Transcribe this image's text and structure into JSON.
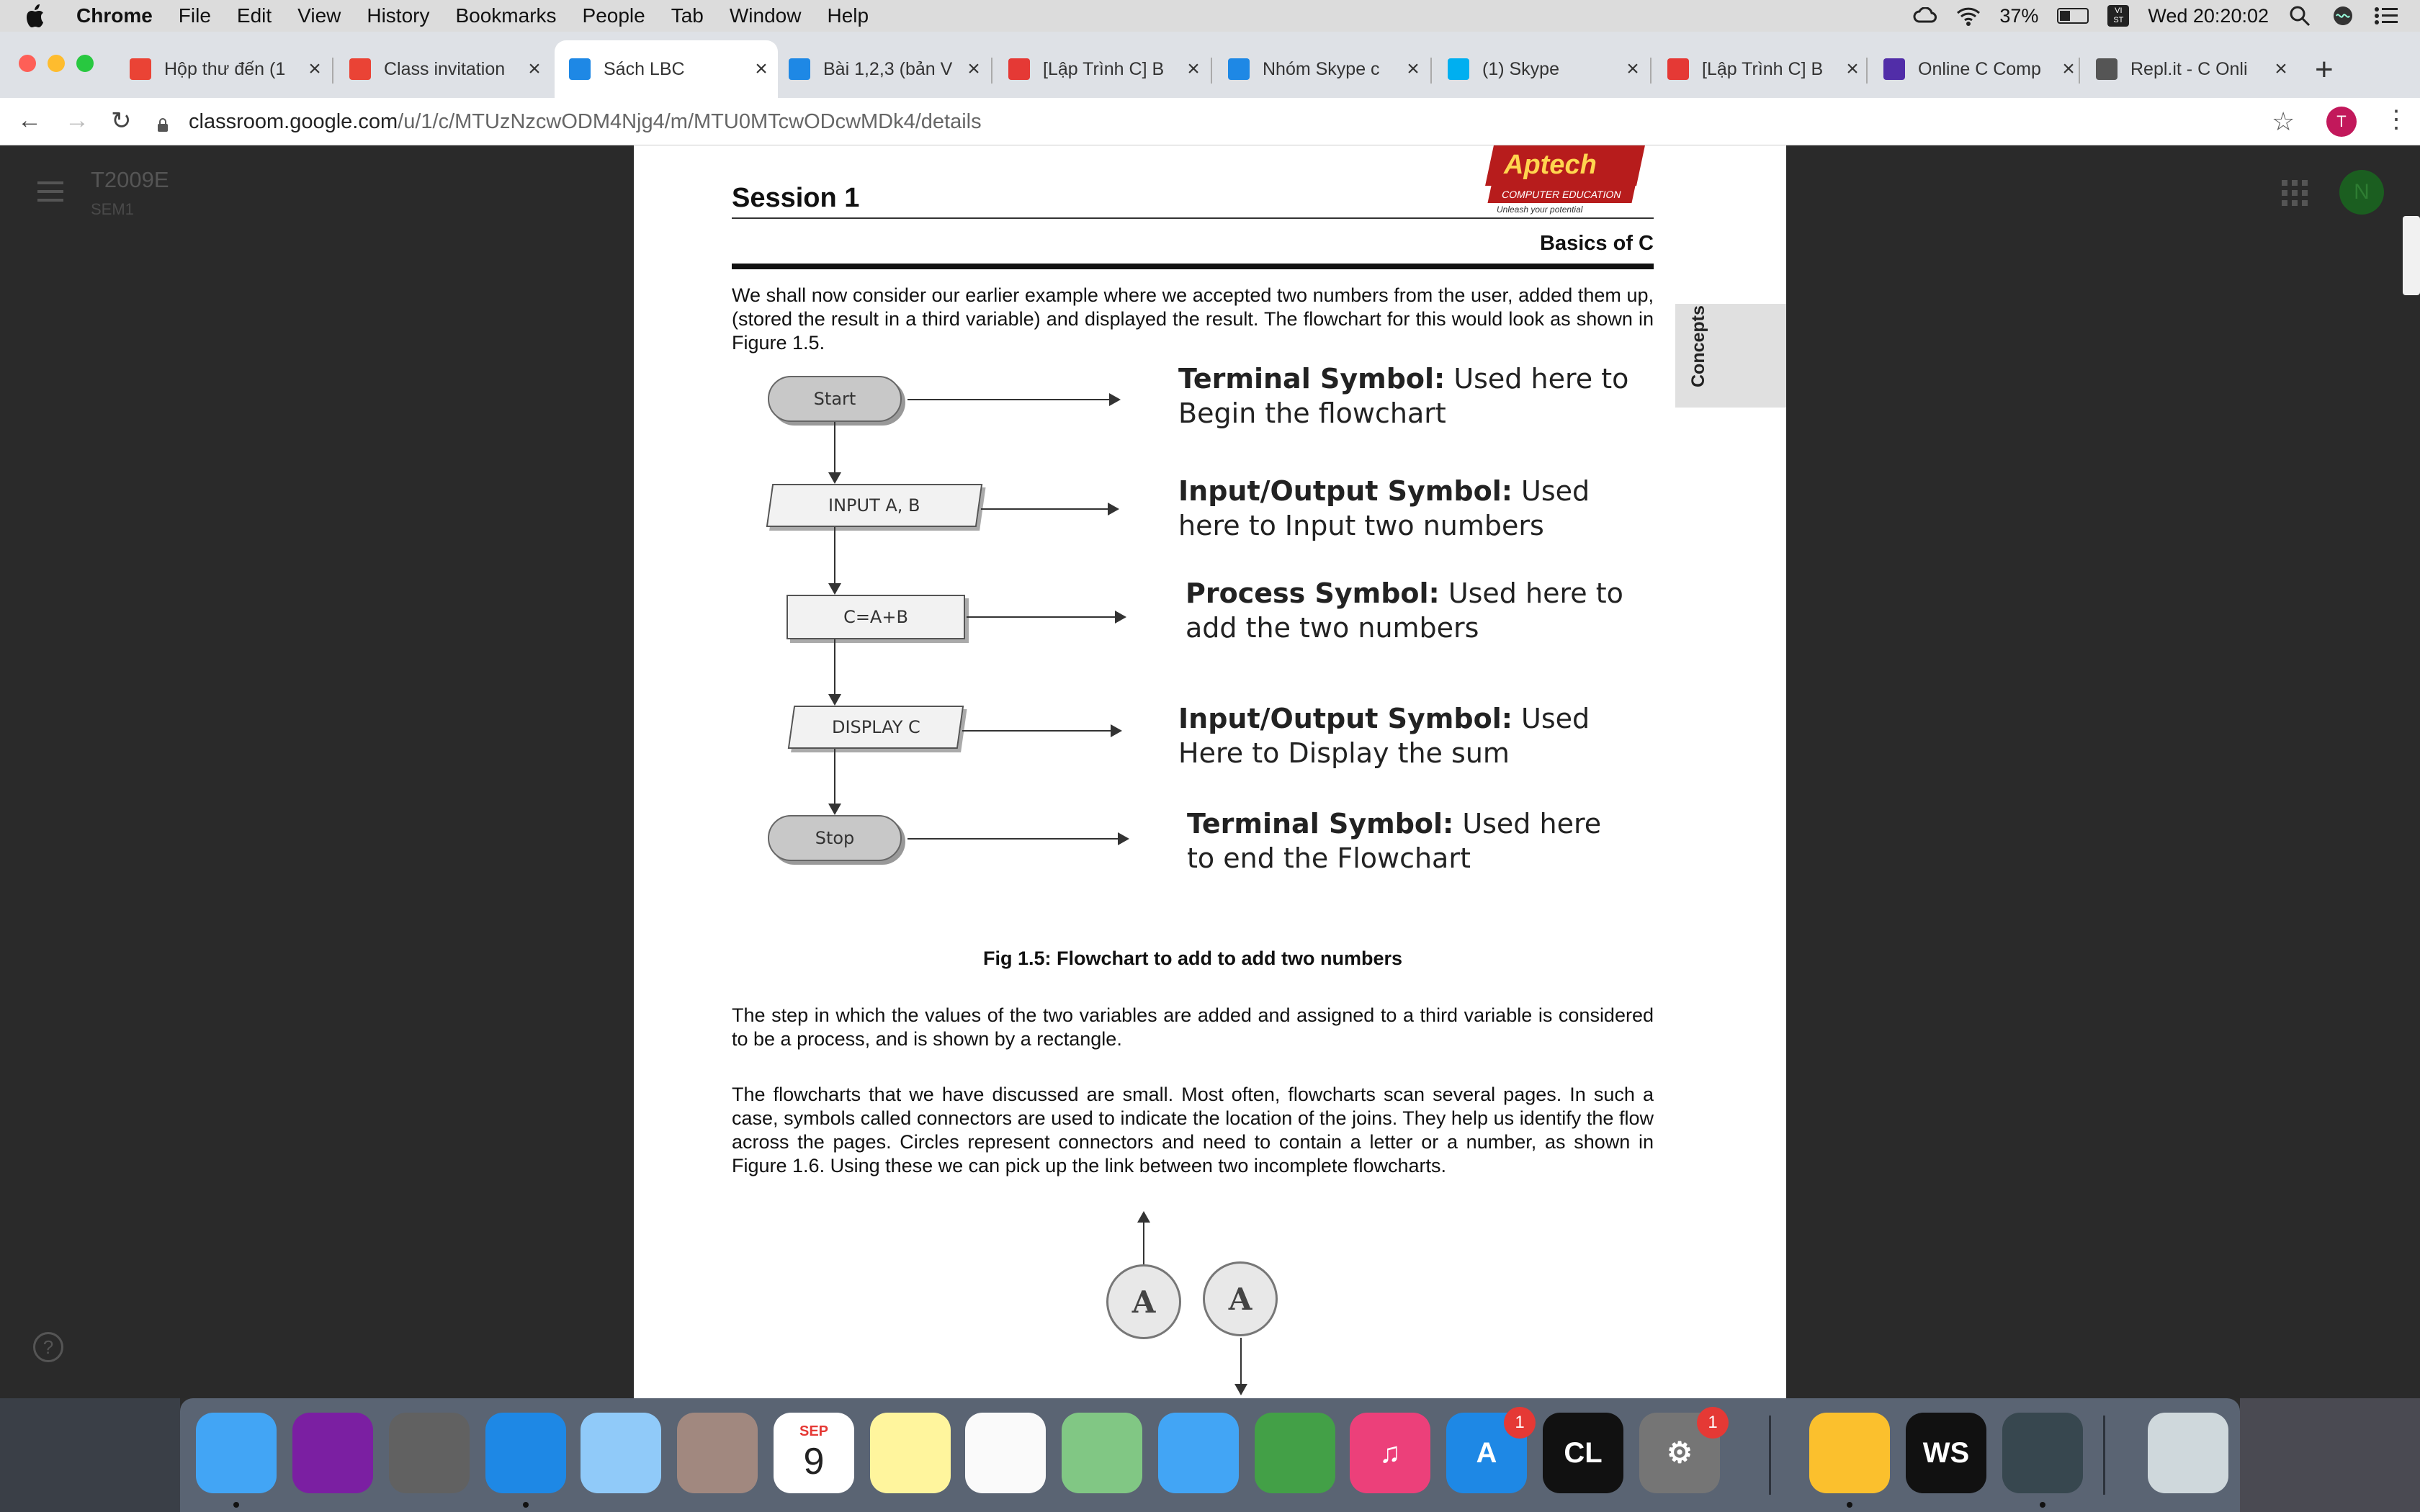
{
  "menubar": {
    "app_name": "Chrome",
    "items": [
      "File",
      "Edit",
      "View",
      "History",
      "Bookmarks",
      "People",
      "Tab",
      "Window",
      "Help"
    ],
    "battery": "37%",
    "battery_level": 0.37,
    "input_source": "VI\nST",
    "datetime": "Wed 20:20:02"
  },
  "tabs": [
    {
      "title": "Hộp thư đến (1",
      "favicon": "gmail-icon",
      "color": "#ea4335"
    },
    {
      "title": "Class invitation",
      "favicon": "gmail-icon",
      "color": "#ea4335"
    },
    {
      "title": "Sách LBC",
      "favicon": "classroom-icon",
      "color": "#1e88e5"
    },
    {
      "title": "Bài 1,2,3 (bản V",
      "favicon": "classroom-icon",
      "color": "#1e88e5"
    },
    {
      "title": "[Lập Trình C] B",
      "favicon": "site-icon",
      "color": "#e53935"
    },
    {
      "title": "Nhóm Skype c",
      "favicon": "classroom-icon",
      "color": "#1e88e5"
    },
    {
      "title": "(1) Skype",
      "favicon": "skype-icon",
      "color": "#00aff0"
    },
    {
      "title": "[Lập Trình C] B",
      "favicon": "site-icon",
      "color": "#e53935"
    },
    {
      "title": "Online C Comp",
      "favicon": "bolt-icon",
      "color": "#512da8"
    },
    {
      "title": "Repl.it - C Onli",
      "favicon": "replit-icon",
      "color": "#555555"
    }
  ],
  "active_tab": 2,
  "omnibox": {
    "host": "classroom.google.com",
    "path": "/u/1/c/MTUzNzcwODM4Njg4/m/MTU0MTcwODcwMDk4/details"
  },
  "profile_initial": "T",
  "classroom": {
    "class_name": "T2009E",
    "section": "SEM1",
    "account_initial": "N"
  },
  "document": {
    "session": "Session 1",
    "subtitle": "Basics of C",
    "logo": {
      "brand": "Aptech",
      "line": "COMPUTER EDUCATION",
      "tagline": "Unleash your potential",
      "tm": "TM"
    },
    "side_tab": "Concepts",
    "intro": "We shall now consider our earlier example where we accepted two numbers from the user, added them up, (stored the result in a third variable) and displayed the result. The flowchart for this would look as shown in Figure 1.5.",
    "flowchart": {
      "nodes": [
        {
          "text": "Start",
          "shape": "terminal"
        },
        {
          "text": "INPUT A, B",
          "shape": "io"
        },
        {
          "text": "C=A+B",
          "shape": "process"
        },
        {
          "text": "DISPLAY C",
          "shape": "io"
        },
        {
          "text": "Stop",
          "shape": "terminal"
        }
      ],
      "labels": [
        {
          "bold": "Terminal Symbol:",
          "line1": " Used here to",
          "line2": "Begin the flowchart"
        },
        {
          "bold": "Input/Output Symbol:",
          "line1": " Used",
          "line2": "here to Input two numbers"
        },
        {
          "bold": "Process Symbol:",
          "line1": " Used here to",
          "line2": "add the two numbers"
        },
        {
          "bold": "Input/Output Symbol:",
          "line1": " Used",
          "line2": "Here to Display the sum"
        },
        {
          "bold": "Terminal Symbol:",
          "line1": " Used here",
          "line2": "to end the Flowchart"
        }
      ]
    },
    "caption": "Fig 1.5: Flowchart to add to add two numbers",
    "para2": "The step in which the values of the two variables are added and assigned to a third variable is considered to be a process, and is shown by a rectangle.",
    "para3": "The flowcharts that we have discussed are small. Most often, flowcharts scan several pages. In such a case, symbols called connectors are used to indicate the location of the joins. They help us identify the flow across the pages. Circles represent connectors and need to contain a letter or a number, as shown in Figure 1.6. Using these we can pick up the link between two incomplete flowcharts.",
    "connectors": [
      "A",
      "A"
    ]
  },
  "dock": {
    "apps": [
      {
        "name": "finder-icon",
        "glyph": "",
        "color": "#42a5f5"
      },
      {
        "name": "siri-icon",
        "glyph": "",
        "color": "#7b1fa2"
      },
      {
        "name": "launchpad-icon",
        "glyph": "",
        "color": "#616161"
      },
      {
        "name": "safari-icon",
        "glyph": "",
        "color": "#1e88e5"
      },
      {
        "name": "mail-icon",
        "glyph": "",
        "color": "#90caf9"
      },
      {
        "name": "contacts-icon",
        "glyph": "",
        "color": "#a1887f"
      },
      {
        "name": "calendar-icon",
        "glyph": "",
        "color": "#ffffff"
      },
      {
        "name": "notes-icon",
        "glyph": "",
        "color": "#fff59d"
      },
      {
        "name": "reminders-icon",
        "glyph": "",
        "color": "#fafafa"
      },
      {
        "name": "maps-icon",
        "glyph": "",
        "color": "#81c784"
      },
      {
        "name": "messages-icon",
        "glyph": "",
        "color": "#42a5f5"
      },
      {
        "name": "facetime-icon",
        "glyph": "",
        "color": "#43a047"
      },
      {
        "name": "music-icon",
        "glyph": "♫",
        "color": "#ec407a"
      },
      {
        "name": "app-store-icon",
        "glyph": "A",
        "color": "#1e88e5"
      },
      {
        "name": "clion-icon",
        "glyph": "CL",
        "color": "#111111"
      },
      {
        "name": "system-preferences-icon",
        "glyph": "⚙",
        "color": "#757575"
      },
      {
        "name": "chrome-icon",
        "glyph": "",
        "color": "#fbc02d"
      },
      {
        "name": "webstorm-icon",
        "glyph": "WS",
        "color": "#111111"
      },
      {
        "name": "downloads-icon",
        "glyph": "",
        "color": "#37474f"
      },
      {
        "name": "trash-icon",
        "glyph": "",
        "color": "#cfd8dc"
      }
    ],
    "calendar": {
      "month": "SEP",
      "day": "9"
    },
    "badges": {
      "app-store-icon": "1",
      "system-preferences-icon": "1"
    }
  }
}
